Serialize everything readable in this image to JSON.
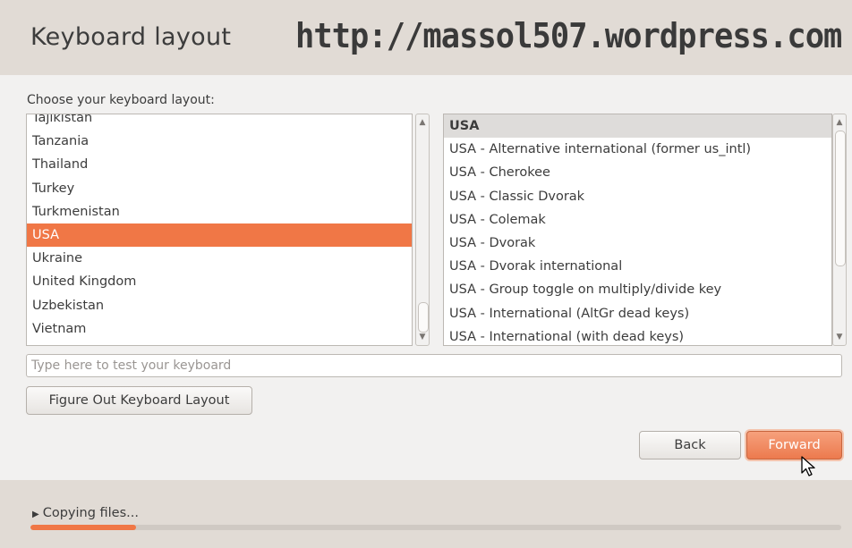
{
  "header": {
    "title": "Keyboard layout",
    "watermark": "http://massol507.wordpress.com"
  },
  "prompt": "Choose your keyboard layout:",
  "layouts": {
    "items": [
      "Tajikistan",
      "Tanzania",
      "Thailand",
      "Turkey",
      "Turkmenistan",
      "USA",
      "Ukraine",
      "United Kingdom",
      "Uzbekistan",
      "Vietnam"
    ],
    "selected": "USA"
  },
  "variants": {
    "items": [
      "USA",
      "USA - Alternative international (former us_intl)",
      "USA - Cherokee",
      "USA - Classic Dvorak",
      "USA - Colemak",
      "USA - Dvorak",
      "USA - Dvorak international",
      "USA - Group toggle on multiply/divide key",
      "USA - International (AltGr dead keys)",
      "USA - International (with dead keys)"
    ],
    "selected": "USA"
  },
  "test_field": {
    "placeholder": "Type here to test your keyboard",
    "value": ""
  },
  "buttons": {
    "figure_out": "Figure Out Keyboard Layout",
    "back": "Back",
    "forward": "Forward"
  },
  "progress": {
    "label": "Copying files...",
    "fraction": 0.13
  },
  "colors": {
    "accent": "#f07746",
    "header_bg": "#e1dbd5"
  }
}
